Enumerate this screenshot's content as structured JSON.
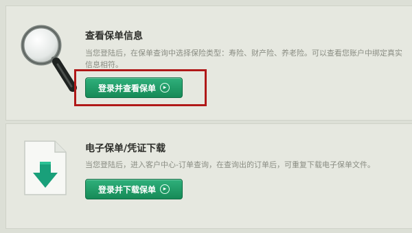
{
  "section_view": {
    "title": "查看保单信息",
    "description": "当您登陆后，在保单查询中选择保险类型：寿险、财产险、养老险。可以查看您账户中绑定真实信息相符。",
    "button_label": "登录并查看保单",
    "icon": "magnifier-icon"
  },
  "section_download": {
    "title": "电子保单/凭证下载",
    "description": "当您登陆后，进入客户中心-订单查询，在查询出的订单后，可重复下载电子保单文件。",
    "button_label": "登录并下载保单",
    "icon": "download-document-icon"
  },
  "colors": {
    "button_green": "#168a57",
    "highlight_red": "#b01818"
  }
}
